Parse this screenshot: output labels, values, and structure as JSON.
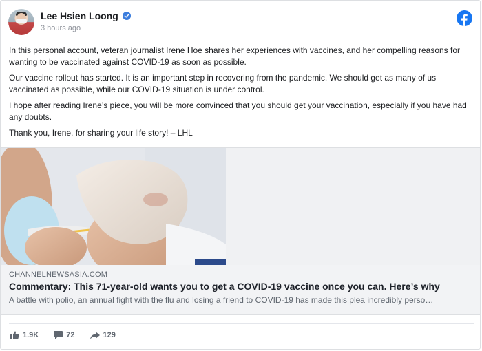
{
  "author": {
    "name": "Lee Hsien Loong",
    "timestamp": "3 hours ago"
  },
  "icons": {
    "avatar": "author-avatar",
    "verified": "verified-badge-icon",
    "platform": "facebook-logo-icon",
    "like": "thumbs-up-icon",
    "comment": "comment-icon",
    "share": "share-arrow-icon"
  },
  "colors": {
    "facebook_blue": "#1877f2",
    "verified_blue": "#3b7ddd",
    "secondary_text": "#606770"
  },
  "post": {
    "paragraphs": [
      "In this personal account, veteran journalist Irene Hoe shares her experiences with vaccines, and her compelling reasons for wanting to be vaccinated against COVID-19 as soon as possible.",
      "Our vaccine rollout has started. It is an important step in recovering from the pandemic. We should get as many of us vaccinated as possible, while our COVID-19 situation is under control.",
      "I hope after reading Irene’s piece, you will be more convinced that you should get your vaccination, especially if you have had any doubts.",
      "Thank you, Irene, for sharing your life story! – LHL"
    ]
  },
  "link": {
    "domain": "CHANNELNEWSASIA.COM",
    "title": "Commentary: This 71-year-old wants you to get a COVID-19 vaccine once you can. Here’s why",
    "description": "A battle with polio, an annual fight with the flu and losing a friend to COVID-19 has made this plea incredibly perso…"
  },
  "stats": {
    "likes": "1.9K",
    "comments": "72",
    "shares": "129"
  }
}
